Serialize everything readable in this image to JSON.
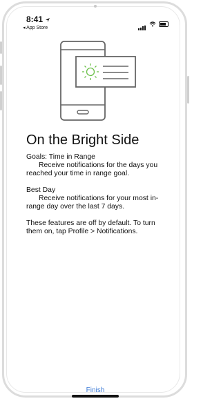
{
  "status": {
    "time": "8:41",
    "back_label": "◂ App Store"
  },
  "screen": {
    "title": "On the Bright Side",
    "goal_heading": "Goals: Time in Range",
    "goal_desc": "Receive notifications for the days you reached your time in range goal.",
    "best_heading": "Best Day",
    "best_desc": "Receive notifications for your most in-range day over the last 7 days.",
    "note": "These features are off by default. To turn them on, tap Profile > Notifications."
  },
  "footer": {
    "finish_label": "Finish"
  },
  "colors": {
    "accent": "#3d7bd6",
    "sun": "#6cc04a"
  },
  "icons": [
    "location-arrow-icon",
    "signal-icon",
    "wifi-icon",
    "battery-icon",
    "phone-illustration-icon",
    "sun-icon"
  ]
}
